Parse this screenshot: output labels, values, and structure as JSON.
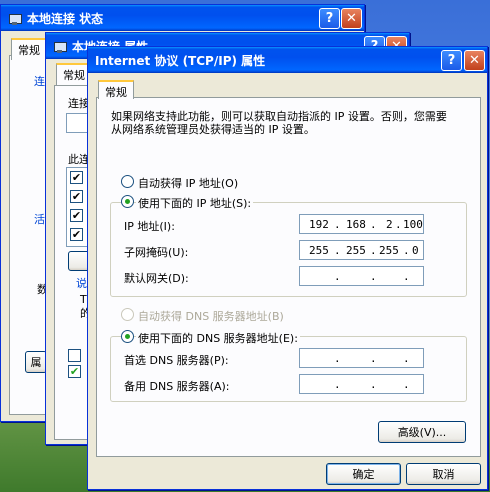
{
  "win1": {
    "title": "本地连接 状态",
    "tab": "常规",
    "frag1": "连",
    "frag2": "活",
    "frag3": "数",
    "frag4": "属"
  },
  "win2": {
    "title": "本地连接 属性",
    "tab": "常规",
    "frag1": "连接",
    "frag2": "此连",
    "frag3": "说",
    "frag4": "T",
    "frag5": "的"
  },
  "dialog": {
    "title": "Internet 协议 (TCP/IP) 属性",
    "help_btn": "?",
    "close_btn": "✕",
    "tab": "常规",
    "description": "如果网络支持此功能，则可以获取自动指派的 IP 设置。否则，您需要从网络系统管理员处获得适当的 IP 设置。",
    "auto_ip_label": "自动获得 IP 地址(O)",
    "manual_ip_label": "使用下面的 IP 地址(S):",
    "ip_address_label": "IP 地址(I):",
    "ip_address": [
      "192",
      "168",
      "2",
      "100"
    ],
    "subnet_label": "子网掩码(U):",
    "subnet": [
      "255",
      "255",
      "255",
      "0"
    ],
    "gateway_label": "默认网关(D):",
    "gateway": [
      "",
      "",
      "",
      ""
    ],
    "auto_dns_label": "自动获得 DNS 服务器地址(B)",
    "manual_dns_label": "使用下面的 DNS 服务器地址(E):",
    "preferred_dns_label": "首选 DNS 服务器(P):",
    "alternate_dns_label": "备用 DNS 服务器(A):",
    "advanced_button": "高级(V)...",
    "ok_button": "确定",
    "cancel_button": "取消",
    "dot": "."
  }
}
